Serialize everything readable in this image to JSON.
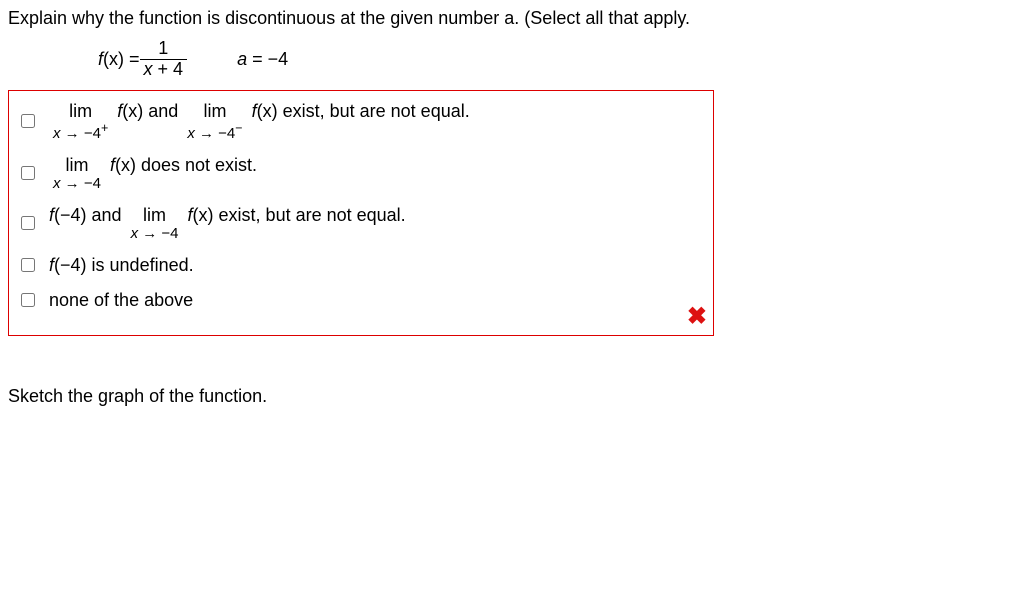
{
  "question": "Explain why the function is discontinuous at the given number a. (Select all that apply.",
  "formula": {
    "lhs_f": "f",
    "lhs_x": "(x) = ",
    "num": "1",
    "den_x": "x",
    "den_rest": " + 4",
    "a_label_a": "a",
    "a_label_rest": " = −4"
  },
  "options": {
    "opt1": {
      "lim1_top": "lim",
      "lim1_bot_x": "x",
      "lim1_bot_rest": " → −4",
      "lim1_sup": "+",
      "fx1_f": "f",
      "fx1_x": "(x)",
      "and": " and ",
      "lim2_top": "lim",
      "lim2_bot_x": "x",
      "lim2_bot_rest": " → −4",
      "lim2_sup": "−",
      "fx2_f": "f",
      "fx2_x": "(x)",
      "tail": " exist, but are not equal."
    },
    "opt2": {
      "lim_top": "lim",
      "lim_bot_x": "x",
      "lim_bot_rest": " → −4",
      "fx_f": "f",
      "fx_x": "(x)",
      "tail": " does not exist."
    },
    "opt3": {
      "fa_f": "f",
      "fa_arg": "(−4)",
      "and": " and ",
      "lim_top": "lim",
      "lim_bot_x": "x",
      "lim_bot_rest": " → −4",
      "fx_f": "f",
      "fx_x": "(x)",
      "tail": " exist, but are not equal."
    },
    "opt4": {
      "fa_f": "f",
      "fa_arg": "(−4)",
      "tail": " is undefined."
    },
    "opt5": {
      "text": "none of the above"
    }
  },
  "wrong_glyph": "✖",
  "sketch_prompt": "Sketch the graph of the function."
}
